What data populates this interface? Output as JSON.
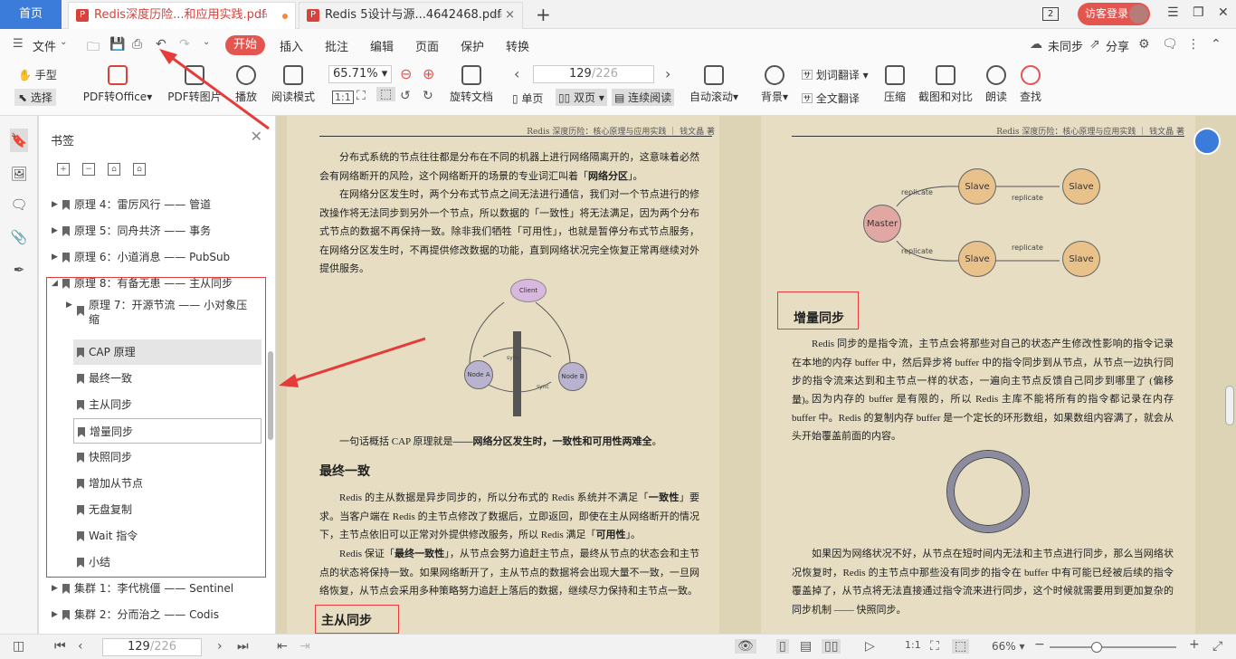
{
  "tabs": {
    "home": "首页",
    "tab1": "Redis深度历险...和应用实践.pdf",
    "tab2": "Redis 5设计与源...4642468.pdf",
    "counter": "2",
    "login": "访客登录"
  },
  "menu": {
    "file": "文件",
    "start": "开始",
    "insert": "插入",
    "annotate": "批注",
    "edit": "编辑",
    "page": "页面",
    "protect": "保护",
    "convert": "转换",
    "sync": "未同步",
    "share": "分享"
  },
  "toolbar": {
    "hand": "手型",
    "select": "选择",
    "pdf_office": "PDF转Office",
    "pdf_img": "PDF转图片",
    "play": "播放",
    "read_mode": "阅读模式",
    "zoom": "65.71%",
    "rotate": "旋转文档",
    "page_num": "129",
    "page_total": "/226",
    "single": "单页",
    "double": "双页",
    "continuous": "连续阅读",
    "autoscroll": "自动滚动",
    "bg": "背景",
    "wordtrans": "划词翻译",
    "fulltrans": "全文翻译",
    "compress": "压缩",
    "screenshot": "截图和对比",
    "readaloud": "朗读",
    "find": "查找"
  },
  "panel": {
    "title": "书签",
    "items": [
      {
        "label": "原理 4：雷厉风行 —— 管道",
        "arrow": "▶"
      },
      {
        "label": "原理 5：同舟共济 —— 事务",
        "arrow": "▶"
      },
      {
        "label": "原理 6：小道消息 —— PubSub",
        "arrow": "▶"
      },
      {
        "label": "原理 8：有备无患 —— 主从同步",
        "arrow": "◢"
      },
      {
        "label": "原理 7：开源节流 —— 小对象压",
        "label2": "缩",
        "arrow": "▶"
      },
      {
        "label": "CAP 原理",
        "arrow": ""
      },
      {
        "label": "最终一致",
        "arrow": ""
      },
      {
        "label": "主从同步",
        "arrow": ""
      },
      {
        "label": "增量同步",
        "arrow": ""
      },
      {
        "label": "快照同步",
        "arrow": ""
      },
      {
        "label": "增加从节点",
        "arrow": ""
      },
      {
        "label": "无盘复制",
        "arrow": ""
      },
      {
        "label": "Wait 指令",
        "arrow": ""
      },
      {
        "label": "小结",
        "arrow": ""
      },
      {
        "label": "集群 1：李代桃僵 —— Sentinel",
        "arrow": "▶"
      },
      {
        "label": "集群 2：分而治之 —— Codis",
        "arrow": "▶"
      }
    ]
  },
  "left_page": {
    "header": "Redis 深度历险：核心原理与应用实践 ｜ 钱文晶 著",
    "p1a": "分布式系统的节点往往都是分布在不同的机器上进行网络隔离开的，这意味着必然会有网络断开的风险，这个网络断开的场景的专业词汇叫着「",
    "p1b": "网络分区",
    "p1c": "」。",
    "p2": "在网络分区发生时，两个分布式节点之间无法进行通信，我们对一个节点进行的修改操作将无法同步到另外一个节点，所以数据的「一致性」将无法满足，因为两个分布式节点的数据不再保持一致。除非我们牺牲「可用性」，也就是暂停分布式节点服务，在网络分区发生时，不再提供修改数据的功能，直到网络状况完全恢复正常再继续对外提供服务。",
    "client": "Client",
    "nodea": "Node A",
    "nodeb": "Node B",
    "sync": "sync",
    "p3a": "一句话概括 CAP 原理就是",
    "p3b": "——网络分区发生时，一致性和可用性两难全",
    "p3c": "。",
    "h1": "最终一致",
    "p4a": "Redis 的主从数据是异步同步的，所以分布式的 Redis 系统并不满足「",
    "p4b": "一致性",
    "p4c": "」要求。当客户端在 Redis 的主节点修改了数据后，立即返回，即使在主从网络断开的情况下，主节点依旧可以正常对外提供修改服务，所以 Redis 满足「",
    "p4d": "可用性",
    "p4e": "」。",
    "p5a": "Redis 保证「",
    "p5b": "最终一致性",
    "p5c": "」，从节点会努力追赶主节点，最终从节点的状态会和主节点的状态将保持一致。如果网络断开了，主从节点的数据将会出现大量不一致，一旦网络恢复，从节点会采用多种策略努力追赶上落后的数据，继续尽力保持和主节点一致。",
    "h2": "主从同步"
  },
  "right_page": {
    "header": "Redis 深度历险：核心原理与应用实践 ｜ 钱文晶 著",
    "master": "Master",
    "slave": "Slave",
    "replicate": "replicate",
    "h1": "增量同步",
    "p1": "Redis 同步的是指令流，主节点会将那些对自己的状态产生修改性影响的指令记录在本地的内存 buffer 中，然后异步将 buffer 中的指令同步到从节点，从节点一边执行同步的指令流来达到和主节点一样的状态，一遍向主节点反馈自己同步到哪里了 (偏移量)。",
    "p2": "因为内存的 buffer 是有限的，所以 Redis 主库不能将所有的指令都记录在内存 buffer 中。Redis 的复制内存 buffer 是一个定长的环形数组，如果数组内容满了，就会从头开始覆盖前面的内容。",
    "p3": "如果因为网络状况不好，从节点在短时间内无法和主节点进行同步，那么当网络状况恢复时，Redis 的主节点中那些没有同步的指令在 buffer 中有可能已经被后续的指令覆盖掉了，从节点将无法直接通过指令流来进行同步，这个时候就需要用到更加复杂的同步机制 —— 快照同步。"
  },
  "status": {
    "page_num": "129",
    "page_total": "/226",
    "zoom": "66%"
  }
}
